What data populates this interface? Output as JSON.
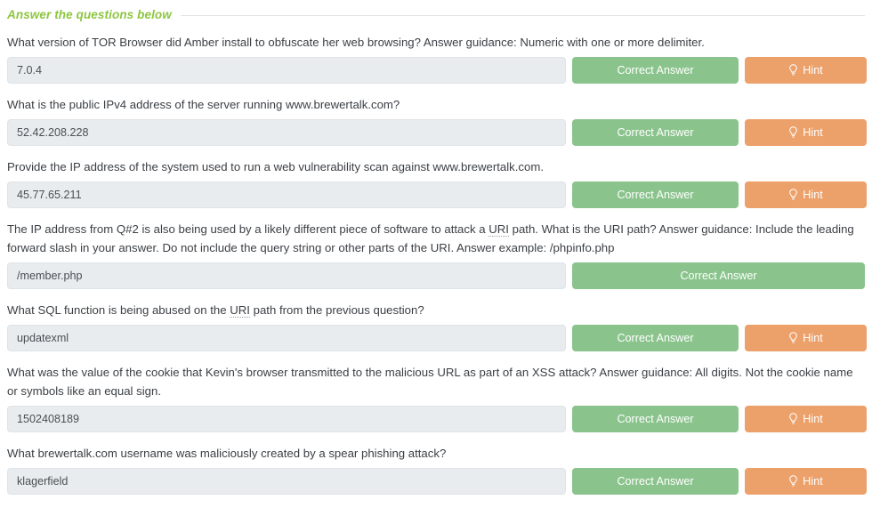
{
  "section": {
    "legend": "Answer the questions below"
  },
  "buttons": {
    "correct_label": "Correct Answer",
    "hint_label": "Hint",
    "hint_icon": "lightbulb-icon"
  },
  "colors": {
    "legend_green": "#8dc63f",
    "correct_green": "#8ac48c",
    "hint_orange": "#eca06a",
    "input_bg": "#e9ecef",
    "text": "#3b3f44",
    "rule": "#e4e4e4"
  },
  "questions": [
    {
      "id": "q1",
      "prompt_parts": [
        {
          "text": "What version of TOR Browser did Amber install to obfuscate her web browsing? Answer guidance: Numeric with one or more delimiter.",
          "abbr": false
        }
      ],
      "prompt": "What version of TOR Browser did Amber install to obfuscate her web browsing? Answer guidance: Numeric with one or more delimiter.",
      "answer": "7.0.4",
      "placeholder": "",
      "has_hint": true
    },
    {
      "id": "q2",
      "prompt": "What is the public IPv4 address of the server running www.brewertalk.com?",
      "answer": "52.42.208.228",
      "placeholder": "",
      "has_hint": true
    },
    {
      "id": "q3",
      "prompt": "Provide the IP address of the system used to run a web vulnerability scan against www.brewertalk.com.",
      "answer": "45.77.65.211",
      "placeholder": "",
      "has_hint": true
    },
    {
      "id": "q4",
      "prompt": "The IP address from Q#2 is also being used by a likely different piece of software to attack a URI path. What is the URI path? Answer guidance: Include the leading forward slash in your answer. Do not include the query string or other parts of the URI. Answer example: /phpinfo.php",
      "prompt_pre": "The IP address from Q#2 is also being used by a likely different piece of software to attack a ",
      "prompt_abbr": "URI",
      "prompt_post": " path. What is the URI path? Answer guidance: Include the leading forward slash in your answer. Do not include the query string or other parts of the URI. Answer example: /phpinfo.php",
      "answer": "/member.php",
      "placeholder": "",
      "has_hint": false
    },
    {
      "id": "q5",
      "prompt": "What SQL function is being abused on the URI path from the previous question?",
      "prompt_pre": "What SQL function is being abused on the ",
      "prompt_abbr": "URI",
      "prompt_post": " path from the previous question?",
      "answer": "updatexml",
      "placeholder": "",
      "has_hint": true
    },
    {
      "id": "q6",
      "prompt": "What was the value of the cookie that Kevin's browser transmitted to the malicious URL as part of an XSS attack? Answer guidance: All digits. Not the cookie name or symbols like an equal sign.",
      "answer": "1502408189",
      "placeholder": "",
      "has_hint": true
    },
    {
      "id": "q7",
      "prompt": "What brewertalk.com username was maliciously created by a spear phishing attack?",
      "answer": "klagerfield",
      "placeholder": "",
      "has_hint": true
    }
  ]
}
